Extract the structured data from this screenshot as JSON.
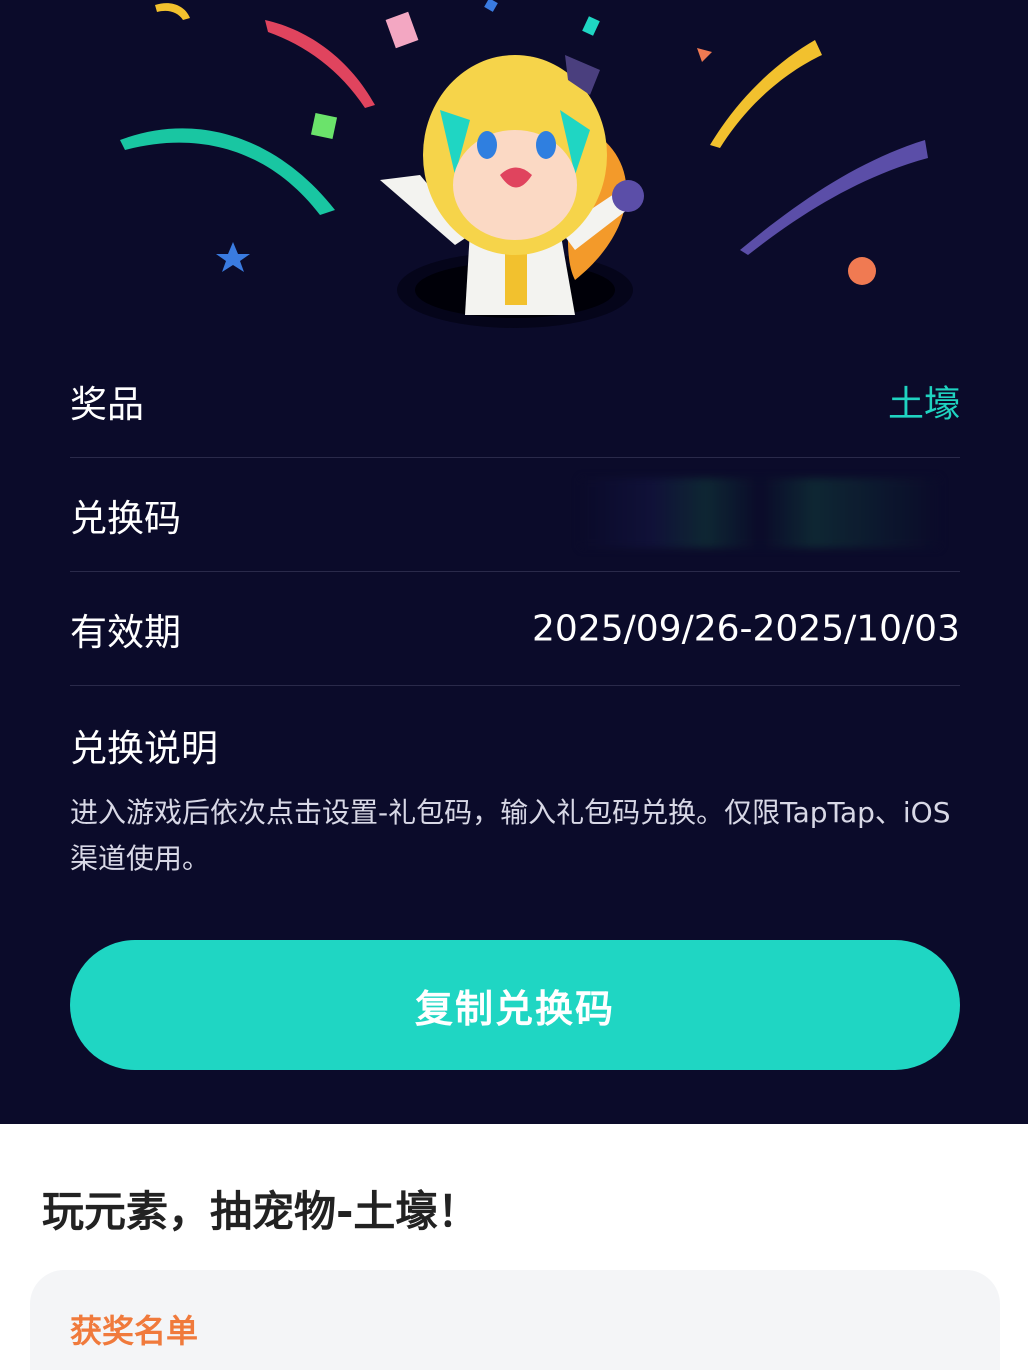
{
  "reward": {
    "prize_label": "奖品",
    "prize_value": "土壕",
    "code_label": "兑换码",
    "validity_label": "有效期",
    "validity_value": "2025/09/26-2025/10/03",
    "instructions_label": "兑换说明",
    "instructions_text": "进入游戏后依次点击设置-礼包码，输入礼包码兑换。仅限TapTap、iOS渠道使用。",
    "copy_button_label": "复制兑换码"
  },
  "event": {
    "title": "玩元素，抽宠物-土壕！",
    "winners_label": "获奖名单"
  },
  "colors": {
    "background_dark": "#0b0b2a",
    "accent_teal": "#1fd6c3",
    "winners_orange": "#f07a3c"
  }
}
